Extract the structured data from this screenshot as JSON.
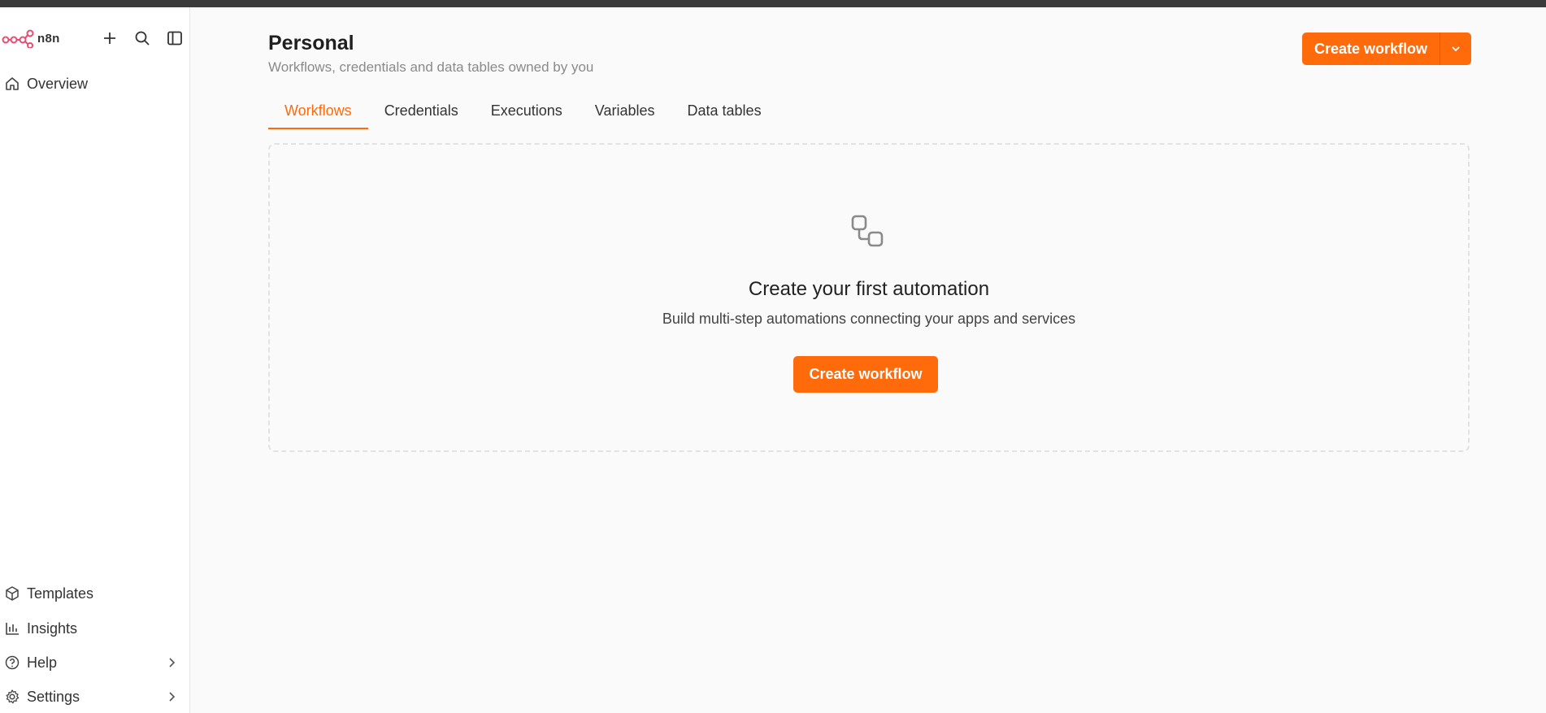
{
  "brand": {
    "name": "n8n",
    "accent": "#ea4b71"
  },
  "sidebar": {
    "top_items": [
      {
        "label": "Overview",
        "icon": "home-icon"
      }
    ],
    "bottom_items": [
      {
        "label": "Templates",
        "icon": "box-icon"
      },
      {
        "label": "Insights",
        "icon": "bar-chart-icon"
      },
      {
        "label": "Help",
        "icon": "help-circle-icon"
      },
      {
        "label": "Settings",
        "icon": "gear-icon"
      }
    ]
  },
  "header": {
    "title": "Personal",
    "subtitle": "Workflows, credentials and data tables owned by you",
    "create_label": "Create workflow"
  },
  "tabs": [
    {
      "label": "Workflows",
      "active": true
    },
    {
      "label": "Credentials",
      "active": false
    },
    {
      "label": "Executions",
      "active": false
    },
    {
      "label": "Variables",
      "active": false
    },
    {
      "label": "Data tables",
      "active": false
    }
  ],
  "empty_state": {
    "title": "Create your first automation",
    "description": "Build multi-step automations connecting your apps and services",
    "button_label": "Create workflow",
    "icon": "workflow-icon"
  },
  "colors": {
    "primary": "#ff6a0a"
  }
}
